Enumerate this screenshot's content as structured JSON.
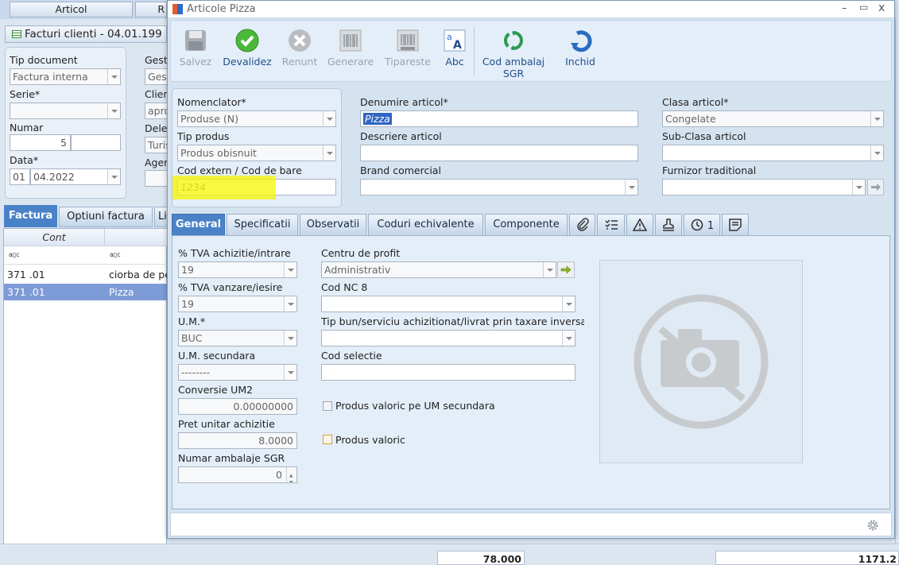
{
  "background": {
    "top_tab_label": "Articol",
    "top_tab_right": "R",
    "window_title": "Facturi clienti - 04.01.199",
    "tip_document_label": "Tip document",
    "tip_document_value": "Factura interna",
    "serie_label": "Serie*",
    "numar_label": "Numar",
    "numar_value": "5",
    "data_label": "Data*",
    "data_day": "01",
    "data_value": "04.2022",
    "gest_label": "Gest",
    "gest_value": "Ges",
    "clien_label": "Clien",
    "clien_value": "apro",
    "dele_label": "Dele",
    "dele_value": "Turis",
    "ager_label": "Ager",
    "tabs": [
      "Factura",
      "Optiuni factura",
      "Li"
    ],
    "grid_header_cont": "Cont",
    "rows": [
      {
        "cont": "371 .01",
        "name": "ciorba de pe"
      },
      {
        "cont": "371 .01",
        "name": "Pizza"
      }
    ],
    "total_qty": "78.000",
    "total_value": "1171.2"
  },
  "modal": {
    "title": "Articole Pizza",
    "win_controls": {
      "min": "–",
      "max": "▭",
      "close": "x"
    },
    "toolbar": [
      {
        "label": "Salvez",
        "enabled": false
      },
      {
        "label": "Devalidez",
        "enabled": true
      },
      {
        "label": "Renunt",
        "enabled": false
      },
      {
        "label": "Generare",
        "enabled": false
      },
      {
        "label": "Tipareste",
        "enabled": false
      },
      {
        "label": "Abc",
        "enabled": true
      },
      {
        "label": "Cod ambalaj SGR",
        "enabled": true
      },
      {
        "label": "Inchid",
        "enabled": true
      }
    ],
    "nomenclator_label": "Nomenclator*",
    "nomenclator_value": "Produse (N)",
    "tip_produs_label": "Tip produs",
    "tip_produs_value": "Produs obisnuit",
    "cod_extern_label": "Cod extern / Cod de bare",
    "cod_extern_value": "1234",
    "denumire_label": "Denumire articol*",
    "denumire_value": "Pizza",
    "descriere_label": "Descriere articol",
    "brand_label": "Brand comercial",
    "clasa_label": "Clasa articol*",
    "clasa_value": "Congelate",
    "subclasa_label": "Sub-Clasa articol",
    "furnizor_label": "Furnizor traditional",
    "tabs": [
      "General",
      "Specificatii",
      "Observatii",
      "Coduri echivalente",
      "Componente"
    ],
    "history_count": "1",
    "general": {
      "tva_achizitie_label": "% TVA achizitie/intrare",
      "tva_achizitie_value": "19",
      "tva_vanzare_label": "% TVA vanzare/iesire",
      "tva_vanzare_value": "19",
      "um_label": "U.M.*",
      "um_value": "BUC",
      "um_secundara_label": "U.M. secundara",
      "um_secundara_value": "--------",
      "conversie_label": "Conversie UM2",
      "conversie_value": "0.00000000",
      "pret_label": "Pret unitar achizitie",
      "pret_value": "8.0000",
      "ambalaje_label": "Numar ambalaje SGR",
      "ambalaje_value": "0",
      "centru_label": "Centru de profit",
      "centru_value": "Administrativ",
      "cod_nc_label": "Cod NC 8",
      "tip_bun_label": "Tip bun/serviciu achizitionat/livrat prin taxare inversa",
      "cod_selectie_label": "Cod selectie",
      "valoric_um2_label": "Produs valoric pe UM secundara",
      "valoric_label": "Produs valoric"
    }
  },
  "colors": {
    "accent": "#4a82c7",
    "highlight": "#f5f500",
    "selected_row": "#7d9bd6"
  }
}
